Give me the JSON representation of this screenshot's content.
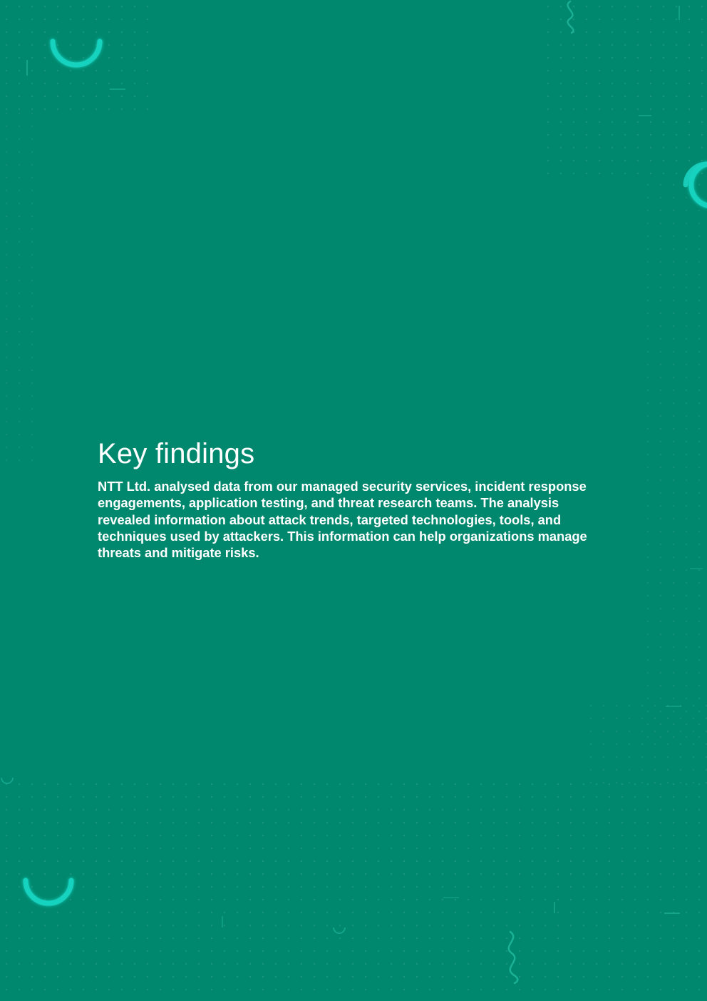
{
  "page": {
    "background_color": "#00886e",
    "accent_color": "#19d3c0"
  },
  "section": {
    "title": "Key findings",
    "body": "NTT Ltd. analysed data from our managed security services, incident response engagements, application testing, and threat research teams. The analysis revealed information about attack trends, targeted technologies, tools, and techniques used by attackers. This information can help organizations manage threats and mitigate risks."
  }
}
